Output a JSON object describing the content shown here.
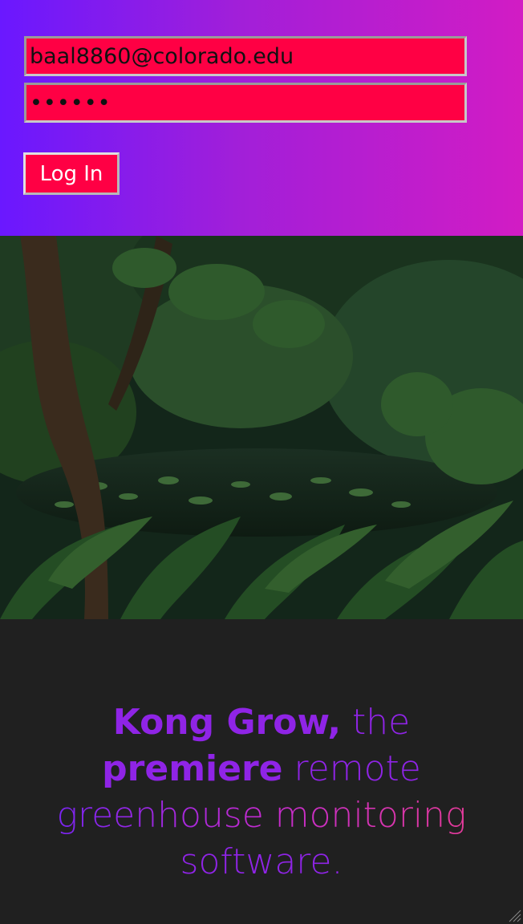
{
  "login": {
    "email_value": "baal8860@colorado.edu",
    "password_value": "••••••",
    "login_button_label": "Log In",
    "colors": {
      "header_gradient_start": "#6a18ff",
      "header_gradient_end": "#d21cc4",
      "field_background": "#ff0044",
      "button_background": "#ff0044"
    }
  },
  "hero": {
    "image_subject": "rainforest greenhouse pond with tropical plants"
  },
  "tagline": {
    "brand": "Kong Grow,",
    "part1": " the",
    "emphasis": "premiere",
    "part2": " remote",
    "line3": "greenhouse monitoring",
    "line4": "software.",
    "colors": {
      "accent": "#8f24e6",
      "gradient_end": "#e33a9a"
    }
  },
  "icons": {
    "resize_handle": "resize-grip-icon"
  }
}
